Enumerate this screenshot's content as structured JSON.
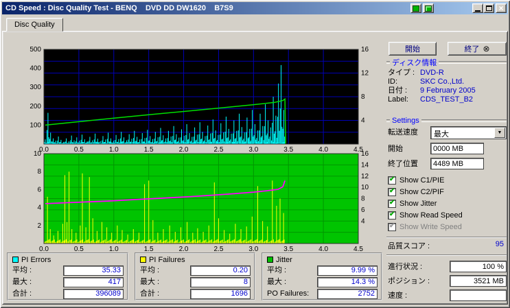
{
  "window": {
    "title": "CD Speed : Disc Quality Test - BENQ    DVD DD DW1620    B7S9"
  },
  "tab": {
    "label": "Disc Quality"
  },
  "buttons": {
    "start": "開始",
    "exit": "終了"
  },
  "disc_info": {
    "heading": "ディスク情報",
    "rows": [
      {
        "label": "タイプ :",
        "value": "DVD-R"
      },
      {
        "label": "ID:",
        "value": "SKC Co.,Ltd."
      },
      {
        "label": "日付 :",
        "value": "9 February 2005"
      },
      {
        "label": "Label:",
        "value": "CDS_TEST_B2"
      }
    ]
  },
  "settings": {
    "heading": "Settings",
    "transfer_label": "転送速度",
    "transfer_value": "最大",
    "start_label": "開始",
    "start_value": "0000 MB",
    "end_label": "終了位置",
    "end_value": "4489 MB",
    "checkboxes": [
      {
        "label": "Show C1/PIE",
        "checked": true,
        "disabled": false
      },
      {
        "label": "Show C2/PIF",
        "checked": true,
        "disabled": false
      },
      {
        "label": "Show Jitter",
        "checked": true,
        "disabled": false
      },
      {
        "label": "Show Read Speed",
        "checked": true,
        "disabled": false
      },
      {
        "label": "Show Write Speed",
        "checked": true,
        "disabled": true
      }
    ],
    "quality_label": "品質スコア :",
    "quality_value": "95"
  },
  "status": {
    "rows": [
      {
        "label": "進行状況 :",
        "value": "100 %"
      },
      {
        "label": "ポジション :",
        "value": "3521 MB"
      },
      {
        "label": "速度 :",
        "value": ""
      }
    ]
  },
  "stats": [
    {
      "title": "PI Errors",
      "color": "#00ffff",
      "rows": [
        {
          "label": "平均 :",
          "value": "35.33"
        },
        {
          "label": "最大 :",
          "value": "417"
        },
        {
          "label": "合計 :",
          "value": "396089"
        }
      ]
    },
    {
      "title": "PI Failures",
      "color": "#ffff00",
      "rows": [
        {
          "label": "平均 :",
          "value": "0.20"
        },
        {
          "label": "最大 :",
          "value": "8"
        },
        {
          "label": "合計 :",
          "value": "1696"
        }
      ]
    },
    {
      "title": "Jitter",
      "color": "#00c000",
      "rows": [
        {
          "label": "平均 :",
          "value": "9.99 %"
        },
        {
          "label": "最大 :",
          "value": "14.3 %"
        },
        {
          "label": "PO Failures:",
          "value": "2752"
        }
      ]
    }
  ],
  "chart_data": [
    {
      "type": "line",
      "title": "PI Errors and Read Speed vs disc position (GB)",
      "bg": "#000000",
      "grid_color": "#0000b6",
      "x_range": [
        0,
        4.5
      ],
      "x_ticks": [
        "0.0",
        "0.5",
        "1.0",
        "1.5",
        "2.0",
        "2.5",
        "3.0",
        "3.5",
        "4.0",
        "4.5"
      ],
      "y_left": {
        "range": [
          0,
          500
        ],
        "ticks": [
          100,
          200,
          300,
          400,
          500
        ]
      },
      "y_right": {
        "range": [
          0,
          16
        ],
        "ticks": [
          4,
          8,
          12,
          16
        ]
      },
      "grid_y_divisions": 8,
      "legend_position": "none",
      "grid": true,
      "series": [
        {
          "name": "PI Errors",
          "type": "spikes",
          "axis": "left",
          "color": "#00ffff",
          "cluster": true,
          "baseline": 8,
          "x_start": 0.02,
          "x_step": 0.0375,
          "x_end": 3.45,
          "values": [
            25,
            165,
            60,
            30,
            18,
            40,
            22,
            12,
            30,
            15,
            45,
            20,
            35,
            18,
            50,
            25,
            15,
            38,
            20,
            55,
            28,
            16,
            42,
            24,
            60,
            30,
            18,
            48,
            26,
            65,
            35,
            20,
            52,
            28,
            70,
            38,
            24,
            58,
            32,
            75,
            42,
            26,
            64,
            36,
            85,
            46,
            30,
            70,
            40,
            95,
            52,
            34,
            78,
            44,
            105,
            58,
            38,
            88,
            50,
            115,
            64,
            42,
            98,
            56,
            130,
            72,
            48,
            110,
            62,
            145,
            80,
            55,
            125,
            70,
            160,
            90,
            62,
            140,
            80,
            180,
            105,
            72,
            160,
            95,
            210,
            125,
            88,
            250,
            150,
            320,
            417,
            180
          ]
        },
        {
          "name": "Read Speed",
          "type": "line",
          "axis": "left",
          "color": "#00e000",
          "width": 1.5,
          "points": [
            [
              0.02,
              100
            ],
            [
              0.5,
              118
            ],
            [
              1.0,
              137
            ],
            [
              1.5,
              155
            ],
            [
              2.0,
              172
            ],
            [
              2.5,
              190
            ],
            [
              3.0,
              208
            ],
            [
              3.3,
              220
            ],
            [
              3.42,
              230
            ],
            [
              3.45,
              238
            ],
            [
              3.46,
              2
            ]
          ]
        }
      ]
    },
    {
      "type": "line",
      "title": "PI Failures and Jitter vs disc position (GB)",
      "bg": "#00c400",
      "grid_color": "#009600",
      "x_range": [
        0,
        4.5
      ],
      "x_ticks": [
        "0.0",
        "0.5",
        "1.0",
        "1.5",
        "2.0",
        "2.5",
        "3.0",
        "3.5",
        "4.0",
        "4.5"
      ],
      "y_left": {
        "range": [
          0,
          10
        ],
        "ticks": [
          2,
          4,
          6,
          8,
          10
        ]
      },
      "y_right": {
        "range": [
          0,
          16
        ],
        "ticks": [
          4,
          6,
          8,
          10,
          12,
          14,
          16
        ]
      },
      "grid_y_divisions": 8,
      "legend_position": "none",
      "grid": true,
      "series": [
        {
          "name": "PI Failures",
          "type": "spikes",
          "axis": "left",
          "color": "#ffff00",
          "baseline": 0.35,
          "x_end": 3.45,
          "points": [
            [
              0.05,
              5.2
            ],
            [
              0.09,
              1.6
            ],
            [
              0.14,
              0.9
            ],
            [
              0.2,
              1.4
            ],
            [
              0.27,
              2.2
            ],
            [
              0.3,
              7.6
            ],
            [
              0.33,
              2.4
            ],
            [
              0.36,
              8.0
            ],
            [
              0.4,
              1.6
            ],
            [
              0.46,
              1.2
            ],
            [
              0.52,
              2.0
            ],
            [
              0.55,
              7.8
            ],
            [
              0.6,
              1.8
            ],
            [
              0.65,
              7.4
            ],
            [
              0.7,
              2.8
            ],
            [
              0.76,
              1.4
            ],
            [
              0.83,
              2.4
            ],
            [
              0.9,
              1.8
            ],
            [
              0.97,
              1.2
            ],
            [
              1.05,
              2.0
            ],
            [
              1.12,
              1.5
            ],
            [
              1.2,
              1.0
            ],
            [
              1.28,
              1.6
            ],
            [
              1.36,
              1.2
            ],
            [
              1.44,
              6.6
            ],
            [
              1.5,
              7.0
            ],
            [
              1.56,
              2.6
            ],
            [
              1.63,
              1.2
            ],
            [
              1.71,
              1.6
            ],
            [
              1.8,
              2.0
            ],
            [
              1.88,
              1.3
            ],
            [
              1.96,
              1.8
            ],
            [
              2.05,
              2.4
            ],
            [
              2.13,
              1.2
            ],
            [
              2.2,
              1.7
            ],
            [
              2.28,
              1.3
            ],
            [
              2.36,
              2.0
            ],
            [
              2.44,
              6.8
            ],
            [
              2.5,
              2.8
            ],
            [
              2.58,
              1.5
            ],
            [
              2.66,
              1.1
            ],
            [
              2.74,
              2.2
            ],
            [
              2.82,
              1.6
            ],
            [
              2.9,
              1.9
            ],
            [
              2.98,
              3.0
            ],
            [
              3.06,
              6.4
            ],
            [
              3.13,
              2.5
            ],
            [
              3.2,
              1.9
            ],
            [
              3.27,
              7.0
            ],
            [
              3.33,
              4.2
            ],
            [
              3.38,
              5.0
            ],
            [
              3.43,
              3.4
            ]
          ]
        },
        {
          "name": "Jitter",
          "type": "line",
          "axis": "right",
          "color": "#ff00ff",
          "width": 1.8,
          "points": [
            [
              0.02,
              7.1
            ],
            [
              0.3,
              7.25
            ],
            [
              0.6,
              7.4
            ],
            [
              0.9,
              7.55
            ],
            [
              1.2,
              7.75
            ],
            [
              1.5,
              7.95
            ],
            [
              1.8,
              8.15
            ],
            [
              2.1,
              8.35
            ],
            [
              2.4,
              8.6
            ],
            [
              2.7,
              8.85
            ],
            [
              3.0,
              9.15
            ],
            [
              3.2,
              9.4
            ],
            [
              3.35,
              9.65
            ],
            [
              3.42,
              10.1
            ],
            [
              3.45,
              11.2
            ]
          ]
        }
      ]
    }
  ]
}
